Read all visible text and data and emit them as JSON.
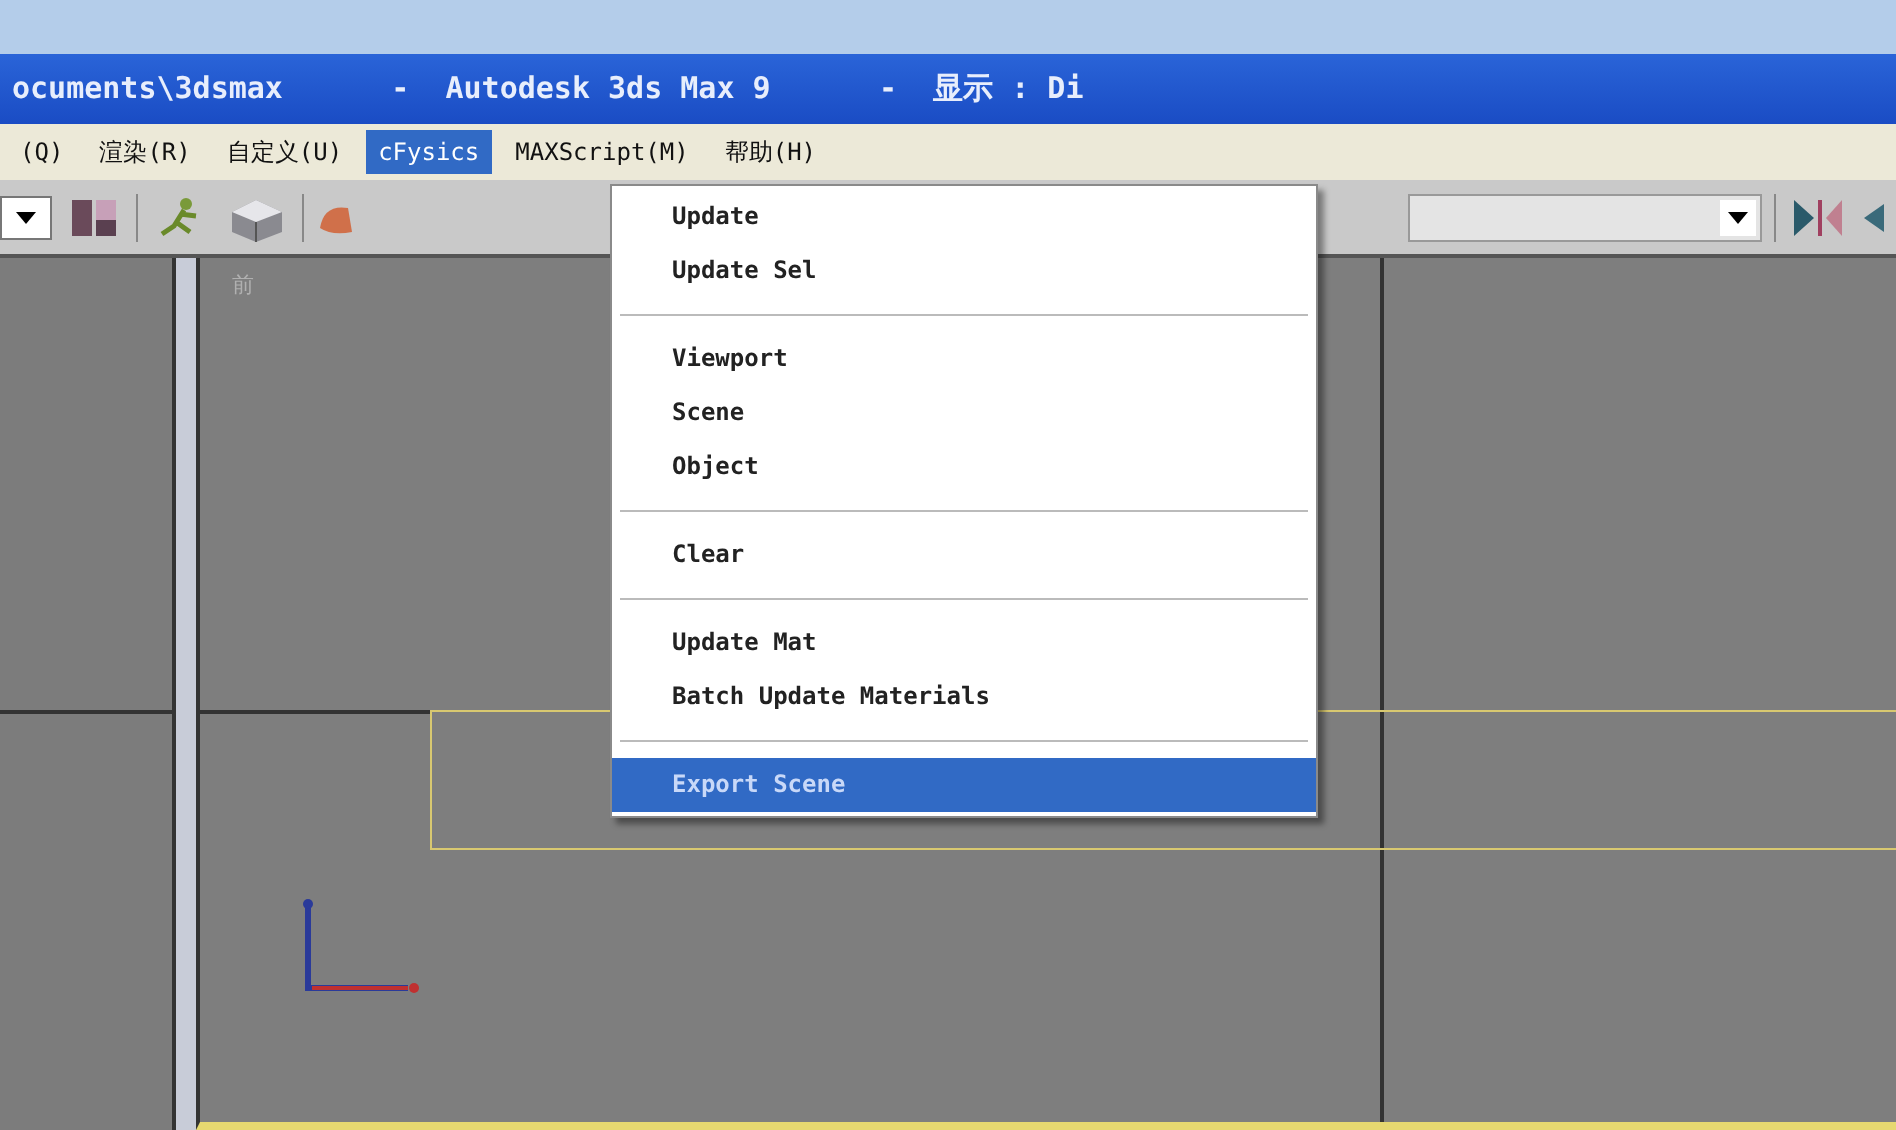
{
  "window": {
    "title": "ocuments\\3dsmax      -  Autodesk 3ds Max 9      -  显示 : Di"
  },
  "menu_bar": [
    {
      "label": "(Q)",
      "selected": false
    },
    {
      "label": "渲染(R)",
      "selected": false
    },
    {
      "label": "自定义(U)",
      "selected": false
    },
    {
      "label": "cFysics",
      "selected": true
    },
    {
      "label": "MAXScript(M)",
      "selected": false
    },
    {
      "label": "帮助(H)",
      "selected": false
    }
  ],
  "dropdown_menu": {
    "items": [
      {
        "kind": "item",
        "label": "Update",
        "selected": false
      },
      {
        "kind": "item",
        "label": "Update Sel",
        "selected": false
      },
      {
        "kind": "separator"
      },
      {
        "kind": "item",
        "label": "Viewport",
        "selected": false
      },
      {
        "kind": "item",
        "label": "Scene",
        "selected": false
      },
      {
        "kind": "item",
        "label": "Object",
        "selected": false
      },
      {
        "kind": "separator"
      },
      {
        "kind": "item",
        "label": "Clear",
        "selected": false
      },
      {
        "kind": "separator"
      },
      {
        "kind": "item",
        "label": "Update Mat",
        "selected": false
      },
      {
        "kind": "item",
        "label": "Batch Update Materials",
        "selected": false
      },
      {
        "kind": "separator"
      },
      {
        "kind": "item",
        "label": "Export Scene",
        "selected": true
      }
    ]
  },
  "viewport": {
    "label": "前"
  }
}
